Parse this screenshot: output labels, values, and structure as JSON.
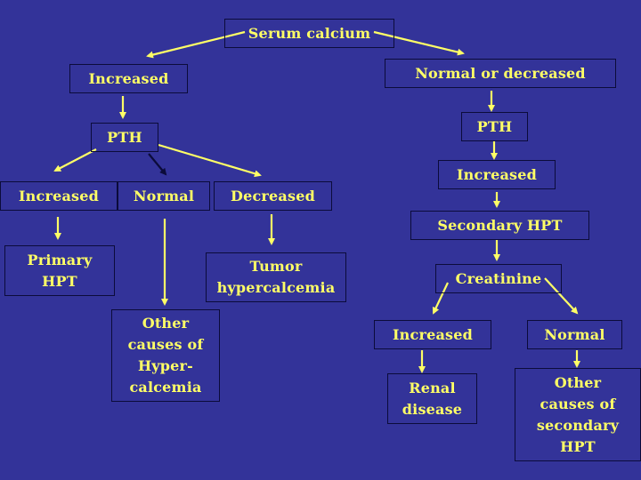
{
  "diagram": {
    "title": "Serum calcium",
    "colors": {
      "background": "#333399",
      "text": "#ffff66",
      "arrow": "#ffff66",
      "arrow_dark": "#0b0b3a",
      "border": "#0b0b3a"
    },
    "nodes": {
      "serum_calcium": "Serum calcium",
      "increased_ca": "Increased",
      "normal_or_decreased_ca": "Normal or decreased",
      "pth_left": "PTH",
      "pth_right": "PTH",
      "pth_increased_left": "Increased",
      "pth_normal_left": "Normal",
      "pth_decreased_left": "Decreased",
      "pth_increased_right": "Increased",
      "secondary_hpt": "Secondary HPT",
      "primary_hpt": "Primary\nHPT",
      "tumor_hypercalcemia": "Tumor\nhypercalcemia",
      "other_causes_hypercalcemia": "Other\ncauses of\nHyper-\ncalcemia",
      "creatinine": "Creatinine",
      "creatinine_increased": "Increased",
      "creatinine_normal": "Normal",
      "renal_disease": "Renal\ndisease",
      "other_causes_secondary_hpt": "Other\ncauses of\nsecondary\nHPT"
    },
    "edges": [
      {
        "from": "serum_calcium",
        "to": "increased_ca"
      },
      {
        "from": "serum_calcium",
        "to": "normal_or_decreased_ca"
      },
      {
        "from": "increased_ca",
        "to": "pth_left"
      },
      {
        "from": "normal_or_decreased_ca",
        "to": "pth_right"
      },
      {
        "from": "pth_left",
        "to": "pth_increased_left"
      },
      {
        "from": "pth_left",
        "to": "pth_normal_left"
      },
      {
        "from": "pth_left",
        "to": "pth_decreased_left"
      },
      {
        "from": "pth_right",
        "to": "pth_increased_right"
      },
      {
        "from": "pth_increased_right",
        "to": "secondary_hpt"
      },
      {
        "from": "pth_increased_left",
        "to": "primary_hpt"
      },
      {
        "from": "pth_normal_left",
        "to": "other_causes_hypercalcemia"
      },
      {
        "from": "pth_decreased_left",
        "to": "tumor_hypercalcemia"
      },
      {
        "from": "secondary_hpt",
        "to": "creatinine"
      },
      {
        "from": "creatinine",
        "to": "creatinine_increased"
      },
      {
        "from": "creatinine",
        "to": "creatinine_normal"
      },
      {
        "from": "creatinine_increased",
        "to": "renal_disease"
      },
      {
        "from": "creatinine_normal",
        "to": "other_causes_secondary_hpt"
      }
    ]
  }
}
